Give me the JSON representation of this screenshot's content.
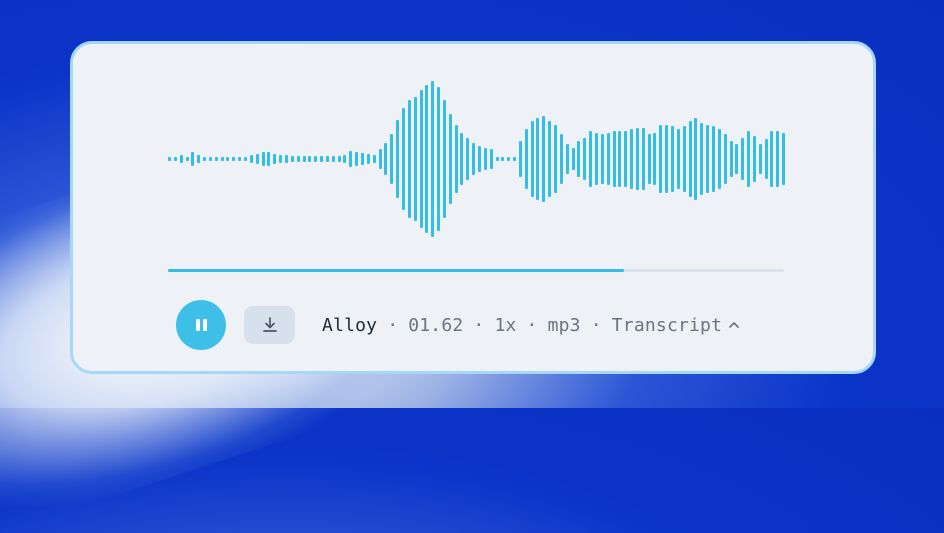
{
  "player": {
    "voice": "Alloy",
    "separator": "·",
    "duration": "01.62",
    "speed": "1x",
    "format": "mp3",
    "transcript_label": "Transcript",
    "progress": 0.74,
    "state": "playing",
    "waveform": [
      0.02,
      0.03,
      0.05,
      0.03,
      0.08,
      0.05,
      0.03,
      0.03,
      0.03,
      0.03,
      0.03,
      0.03,
      0.03,
      0.03,
      0.05,
      0.06,
      0.08,
      0.08,
      0.06,
      0.05,
      0.05,
      0.04,
      0.04,
      0.04,
      0.04,
      0.04,
      0.04,
      0.04,
      0.04,
      0.04,
      0.05,
      0.1,
      0.08,
      0.07,
      0.06,
      0.05,
      0.12,
      0.2,
      0.3,
      0.48,
      0.62,
      0.72,
      0.76,
      0.84,
      0.9,
      0.95,
      0.88,
      0.72,
      0.55,
      0.42,
      0.32,
      0.26,
      0.2,
      0.16,
      0.14,
      0.12,
      0.02,
      0.02,
      0.03,
      0.02,
      0.22,
      0.36,
      0.46,
      0.5,
      0.52,
      0.46,
      0.42,
      0.3,
      0.18,
      0.14,
      0.22,
      0.26,
      0.34,
      0.32,
      0.3,
      0.32,
      0.34,
      0.34,
      0.34,
      0.36,
      0.38,
      0.38,
      0.3,
      0.32,
      0.42,
      0.42,
      0.4,
      0.36,
      0.4,
      0.46,
      0.5,
      0.44,
      0.42,
      0.4,
      0.36,
      0.3,
      0.22,
      0.18,
      0.26,
      0.34,
      0.28,
      0.18,
      0.24,
      0.34,
      0.34,
      0.32
    ]
  },
  "colors": {
    "accent": "#35bde3",
    "card_border": "#a6d7f7",
    "card_bg": "#eef1f6"
  },
  "icons": {
    "pause": "pause-icon",
    "download": "download-icon",
    "chevron": "chevron-up-icon"
  }
}
